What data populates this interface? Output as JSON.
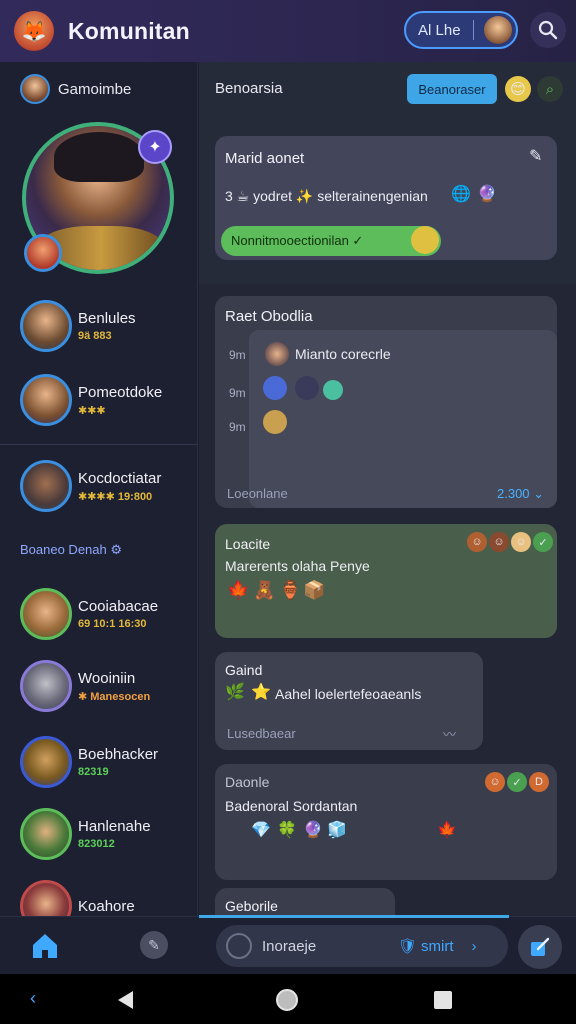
{
  "app": {
    "title": "Komunitan",
    "ai_label": "Al Lhe"
  },
  "sidebar": {
    "user_name": "Gamoimbe",
    "contacts": [
      {
        "name": "Benlules",
        "sub": "9ä 883",
        "sub_color": "#e2b83a"
      },
      {
        "name": "Pomeotdoke",
        "sub": "✱✱✱",
        "sub_color": "#e2b83a"
      },
      {
        "name": "Kocdoctiatar",
        "sub": "✱✱✱✱ 19:800",
        "sub_color": "#e2b83a"
      },
      {
        "name": "Cooiabacae",
        "sub": "69 10:1 16:30",
        "sub_color": "#e2b83a"
      },
      {
        "name": "Wooiniin",
        "sub": "✱ Manesocen",
        "sub_color": "#f0a040"
      },
      {
        "name": "Boebhacker",
        "sub": "82319",
        "sub_color": "#5ccf5a"
      },
      {
        "name": "Hanlenahe",
        "sub": "823012",
        "sub_color": "#5ccf5a"
      },
      {
        "name": "Koahore",
        "sub": "",
        "sub_color": "#e2b83a"
      }
    ],
    "section_label": "Boaneo Denah ⚙"
  },
  "main": {
    "header_title": "Benoarsia",
    "header_button": "Beanoraser",
    "card1": {
      "title": "Marid aonet",
      "text": "3 ☕ yodret ✨ selterainengenian",
      "pill": "Nonnitmooectionilan ✓"
    },
    "card2": {
      "title": "Raet Obodlia",
      "rows": [
        {
          "label": "9m",
          "text": "Mianto corecrle"
        },
        {
          "label": "9m",
          "text": ""
        },
        {
          "label": "9m",
          "text": ""
        }
      ],
      "footer_left": "Loeonlane",
      "footer_right": "2.300 ⌄"
    },
    "card3": {
      "title": "Loacite",
      "text": "Marerents olaha Penye"
    },
    "card4": {
      "title": "Gaind",
      "text": "Aahel   loelertefeoaeanls",
      "footer": "Lusedbaear"
    },
    "card5": {
      "title": "Daonle",
      "text": "Badenoral Sordantan"
    },
    "card6": {
      "title": "Geborile"
    }
  },
  "composer": {
    "placeholder": "Inoraeje",
    "send_label": "smirt"
  },
  "colors": {
    "accent": "#3fa8e8",
    "green": "#5cbd5a",
    "bg": "#1a1d2b"
  }
}
